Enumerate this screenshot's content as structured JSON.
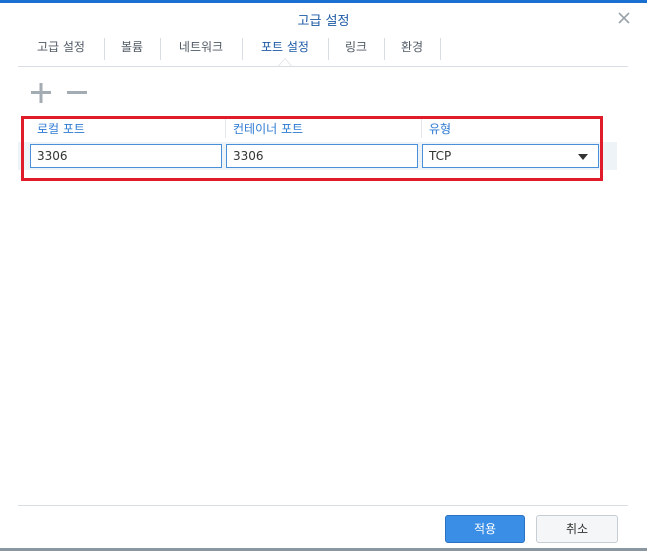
{
  "dialog": {
    "title": "고급 설정"
  },
  "tabs": [
    {
      "label": "고급 설정",
      "active": false
    },
    {
      "label": "볼륨",
      "active": false
    },
    {
      "label": "네트워크",
      "active": false
    },
    {
      "label": "포트 설정",
      "active": true
    },
    {
      "label": "링크",
      "active": false
    },
    {
      "label": "환경",
      "active": false
    }
  ],
  "toolbar": {
    "add_icon": "plus-icon",
    "remove_icon": "minus-icon"
  },
  "port_table": {
    "columns": [
      "로컬 포트",
      "컨테이너 포트",
      "유형"
    ],
    "rows": [
      {
        "local_port": "3306",
        "container_port": "3306",
        "type": "TCP"
      }
    ]
  },
  "footer": {
    "apply_label": "적용",
    "cancel_label": "취소"
  },
  "colors": {
    "accent": "#1a6fd0",
    "highlight_border": "#e01b2a",
    "primary_button": "#3a8ee6"
  }
}
